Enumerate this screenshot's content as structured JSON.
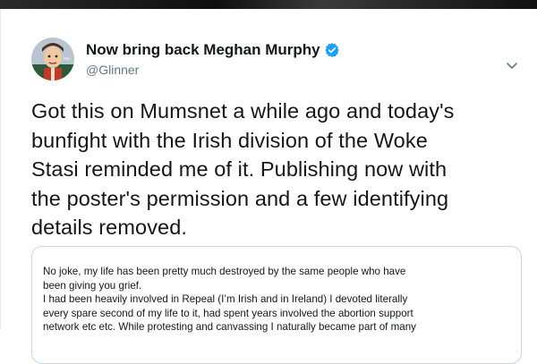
{
  "tweet": {
    "display_name": "Now bring back Meghan Murphy",
    "handle": "@Glinner",
    "text_lines": [
      "Got this on Mumsnet a while ago and today's",
      "bunfight with the Irish division of the Woke",
      "Stasi reminded me of it. Publishing now with",
      "the poster's permission and a few identifying",
      "details removed."
    ]
  },
  "quote": {
    "lines": [
      "No joke, my life has been pretty much destroyed by the same people who have",
      "been giving you grief.",
      "I had been heavily involved in Repeal (I’m Irish and in Ireland) I devoted literally",
      "every spare second of my life to it, had spent years involved the abortion support",
      "network etc etc. While protesting and canvassing I naturally became part of many"
    ]
  },
  "icons": {
    "verified": "verified-badge-icon",
    "caret": "chevron-down-icon",
    "avatar": "avatar"
  },
  "colors": {
    "verified_blue": "#1da1f2",
    "text": "#14171a",
    "secondary": "#657786",
    "border": "#ccd6dd"
  }
}
